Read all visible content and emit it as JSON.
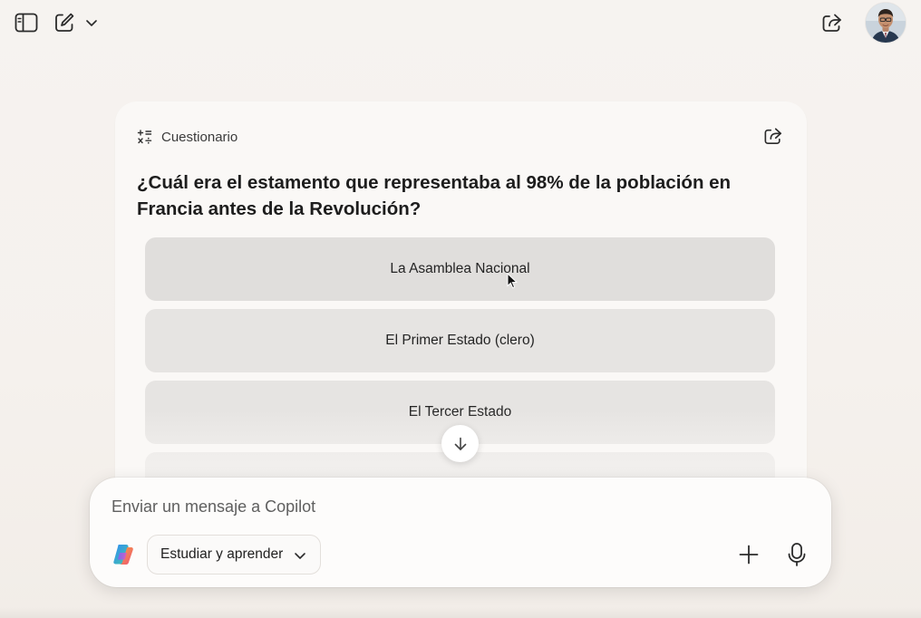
{
  "topbar": {
    "icons": {
      "sidebar": "sidebar-toggle-icon",
      "new_chat": "compose-icon",
      "new_chat_menu": "chevron-down-icon",
      "share": "share-icon",
      "avatar": "user-avatar"
    }
  },
  "quiz": {
    "label": "Cuestionario",
    "question": "¿Cuál era el estamento que representaba al 98% de la población en Francia antes de la Revolución?",
    "options": [
      {
        "label": "La Asamblea Nacional"
      },
      {
        "label": "El Primer Estado (clero)"
      },
      {
        "label": "El Tercer Estado"
      },
      {
        "label": ""
      }
    ]
  },
  "composer": {
    "placeholder": "Enviar un mensaje a Copilot",
    "mode_label": "Estudiar y aprender"
  },
  "colors": {
    "background": "#f5f1ed",
    "card": "#faf8f6",
    "option": "#e6e4e2",
    "text": "#1f1f1f"
  }
}
